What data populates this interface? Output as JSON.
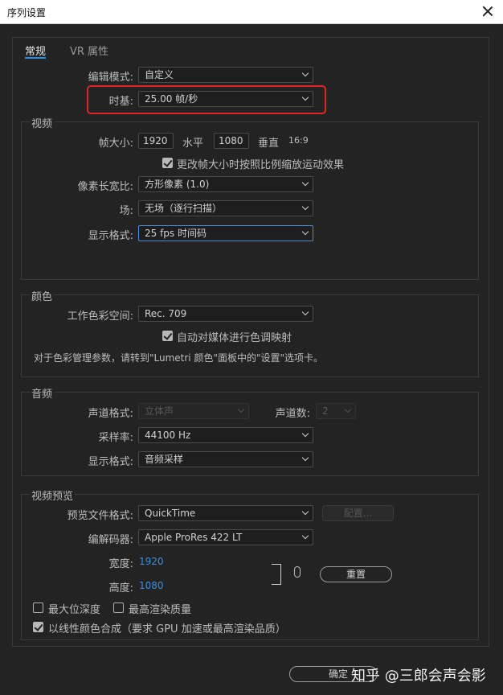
{
  "window": {
    "title": "序列设置"
  },
  "tabs": {
    "general": "常规",
    "vr": "VR 属性"
  },
  "general": {
    "editing_mode": {
      "label": "编辑模式:",
      "value": "自定义"
    },
    "timebase": {
      "label": "时基:",
      "value": "25.00  帧/秒"
    }
  },
  "video": {
    "title": "视频",
    "frame_size_label": "帧大小:",
    "width": "1920",
    "horizontal_label": "水平",
    "height": "1080",
    "vertical_label": "垂直",
    "aspect": "16:9",
    "scale_checkbox": "更改帧大小时按照比例缩放运动效果",
    "pixel_aspect": {
      "label": "像素长宽比:",
      "value": "方形像素 (1.0)"
    },
    "fields": {
      "label": "场:",
      "value": "无场（逐行扫描）"
    },
    "display_format": {
      "label": "显示格式:",
      "value": "25 fps 时间码"
    }
  },
  "color": {
    "title": "颜色",
    "working_space": {
      "label": "工作色彩空间:",
      "value": "Rec. 709"
    },
    "auto_tone_checkbox": "自动对媒体进行色调映射",
    "note": "对于色彩管理参数，请转到\"Lumetri 颜色\"面板中的\"设置\"选项卡。"
  },
  "audio": {
    "title": "音频",
    "channel_format": {
      "label": "声道格式:",
      "value": "立体声"
    },
    "channels": {
      "label": "声道数:",
      "value": "2"
    },
    "sample_rate": {
      "label": "采样率:",
      "value": "44100 Hz"
    },
    "display_format": {
      "label": "显示格式:",
      "value": "音频采样"
    }
  },
  "preview": {
    "title": "视频预览",
    "file_format": {
      "label": "预览文件格式:",
      "value": "QuickTime"
    },
    "config_button": "配置...",
    "codec": {
      "label": "编解码器:",
      "value": "Apple ProRes 422 LT"
    },
    "width_label": "宽度:",
    "width_value": "1920",
    "height_label": "高度:",
    "height_value": "1080",
    "reset_button": "重置",
    "max_depth": "最大位深度",
    "max_quality": "最高渲染质量",
    "linear_color": "以线性颜色合成（要求 GPU 加速或最高渲染品质）"
  },
  "footer": {
    "ok_button": "确定",
    "watermark": "知乎 @三郎会声会影"
  }
}
